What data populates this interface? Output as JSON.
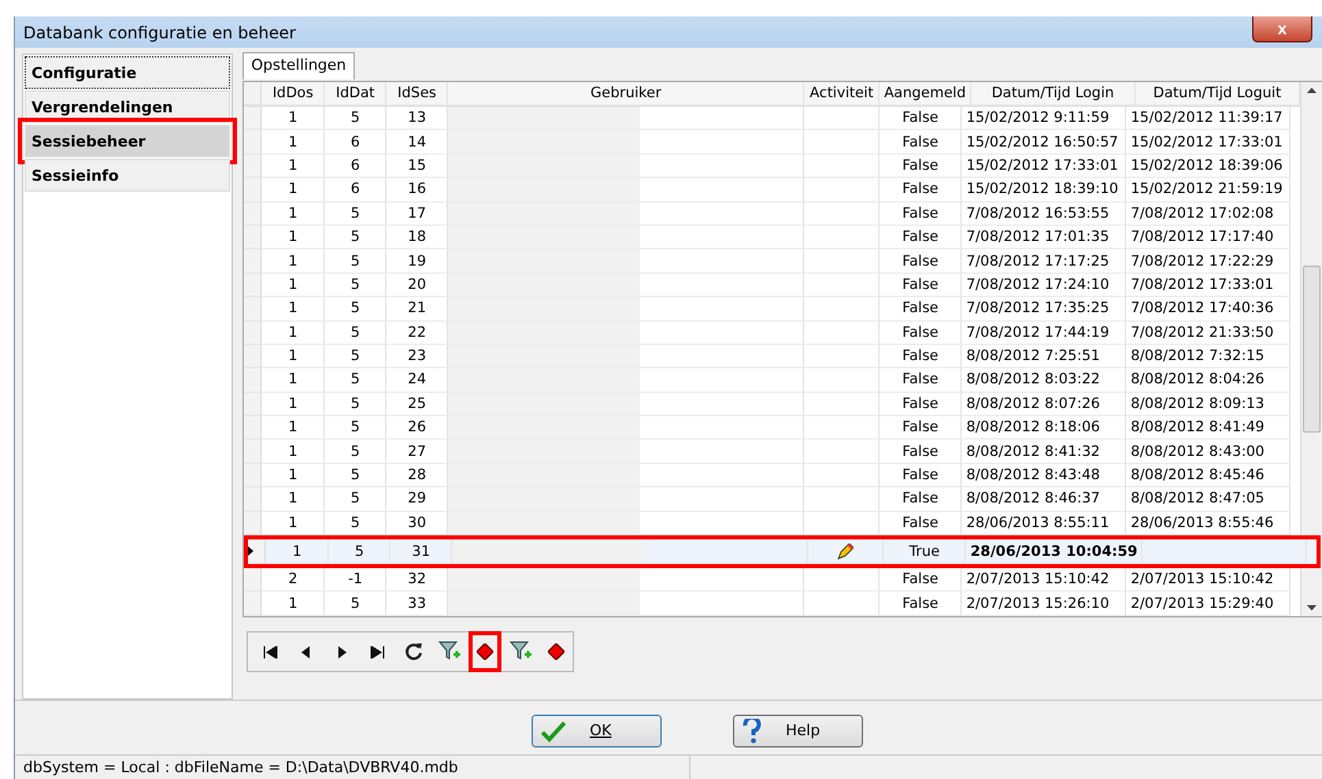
{
  "window": {
    "title": "Databank configuratie en beheer",
    "close": "x"
  },
  "nav": [
    {
      "label": "Configuratie",
      "selected": false,
      "focused": true,
      "highlighted": false
    },
    {
      "label": "Vergrendelingen",
      "selected": false,
      "focused": false,
      "highlighted": false
    },
    {
      "label": "Sessiebeheer",
      "selected": true,
      "focused": false,
      "highlighted": true
    },
    {
      "label": "Sessieinfo",
      "selected": false,
      "focused": false,
      "highlighted": false
    }
  ],
  "tabs": [
    {
      "label": "Opstellingen",
      "selected": true
    }
  ],
  "table": {
    "columns": [
      "IdDos",
      "IdDat",
      "IdSes",
      "Gebruiker",
      "Activiteit",
      "Aangemeld",
      "Datum/Tijd Login",
      "Datum/Tijd Loguit"
    ],
    "rows": [
      {
        "cells": [
          "1",
          "5",
          "13",
          "",
          "",
          "False",
          "15/02/2012 9:11:59",
          "15/02/2012 11:39:17"
        ],
        "selected": false,
        "editing": false
      },
      {
        "cells": [
          "1",
          "6",
          "14",
          "",
          "",
          "False",
          "15/02/2012 16:50:57",
          "15/02/2012 17:33:01"
        ],
        "selected": false,
        "editing": false
      },
      {
        "cells": [
          "1",
          "6",
          "15",
          "",
          "",
          "False",
          "15/02/2012 17:33:01",
          "15/02/2012 18:39:06"
        ],
        "selected": false,
        "editing": false
      },
      {
        "cells": [
          "1",
          "6",
          "16",
          "",
          "",
          "False",
          "15/02/2012 18:39:10",
          "15/02/2012 21:59:19"
        ],
        "selected": false,
        "editing": false
      },
      {
        "cells": [
          "1",
          "5",
          "17",
          "",
          "",
          "False",
          "7/08/2012 16:53:55",
          "7/08/2012 17:02:08"
        ],
        "selected": false,
        "editing": false
      },
      {
        "cells": [
          "1",
          "5",
          "18",
          "",
          "",
          "False",
          "7/08/2012 17:01:35",
          "7/08/2012 17:17:40"
        ],
        "selected": false,
        "editing": false
      },
      {
        "cells": [
          "1",
          "5",
          "19",
          "",
          "",
          "False",
          "7/08/2012 17:17:25",
          "7/08/2012 17:22:29"
        ],
        "selected": false,
        "editing": false
      },
      {
        "cells": [
          "1",
          "5",
          "20",
          "",
          "",
          "False",
          "7/08/2012 17:24:10",
          "7/08/2012 17:33:01"
        ],
        "selected": false,
        "editing": false
      },
      {
        "cells": [
          "1",
          "5",
          "21",
          "",
          "",
          "False",
          "7/08/2012 17:35:25",
          "7/08/2012 17:40:36"
        ],
        "selected": false,
        "editing": false
      },
      {
        "cells": [
          "1",
          "5",
          "22",
          "",
          "",
          "False",
          "7/08/2012 17:44:19",
          "7/08/2012 21:33:50"
        ],
        "selected": false,
        "editing": false
      },
      {
        "cells": [
          "1",
          "5",
          "23",
          "",
          "",
          "False",
          "8/08/2012 7:25:51",
          "8/08/2012 7:32:15"
        ],
        "selected": false,
        "editing": false
      },
      {
        "cells": [
          "1",
          "5",
          "24",
          "",
          "",
          "False",
          "8/08/2012 8:03:22",
          "8/08/2012 8:04:26"
        ],
        "selected": false,
        "editing": false
      },
      {
        "cells": [
          "1",
          "5",
          "25",
          "",
          "",
          "False",
          "8/08/2012 8:07:26",
          "8/08/2012 8:09:13"
        ],
        "selected": false,
        "editing": false
      },
      {
        "cells": [
          "1",
          "5",
          "26",
          "",
          "",
          "False",
          "8/08/2012 8:18:06",
          "8/08/2012 8:41:49"
        ],
        "selected": false,
        "editing": false
      },
      {
        "cells": [
          "1",
          "5",
          "27",
          "",
          "",
          "False",
          "8/08/2012 8:41:32",
          "8/08/2012 8:43:00"
        ],
        "selected": false,
        "editing": false
      },
      {
        "cells": [
          "1",
          "5",
          "28",
          "",
          "",
          "False",
          "8/08/2012 8:43:48",
          "8/08/2012 8:45:46"
        ],
        "selected": false,
        "editing": false
      },
      {
        "cells": [
          "1",
          "5",
          "29",
          "",
          "",
          "False",
          "8/08/2012 8:46:37",
          "8/08/2012 8:47:05"
        ],
        "selected": false,
        "editing": false
      },
      {
        "cells": [
          "1",
          "5",
          "30",
          "",
          "",
          "False",
          "28/06/2013 8:55:11",
          "28/06/2013 8:55:46"
        ],
        "selected": false,
        "editing": false
      },
      {
        "cells": [
          "1",
          "5",
          "31",
          "",
          "",
          "True",
          "28/06/2013 10:04:59",
          ""
        ],
        "selected": true,
        "editing": true
      },
      {
        "cells": [
          "2",
          "-1",
          "32",
          "",
          "",
          "False",
          "2/07/2013 15:10:42",
          "2/07/2013 15:10:42"
        ],
        "selected": false,
        "editing": false
      },
      {
        "cells": [
          "1",
          "5",
          "33",
          "",
          "",
          "False",
          "2/07/2013 15:26:10",
          "2/07/2013 15:29:40"
        ],
        "selected": false,
        "editing": false
      }
    ]
  },
  "toolbar": [
    {
      "kind": "first",
      "highlighted": false
    },
    {
      "kind": "prev",
      "highlighted": false
    },
    {
      "kind": "next",
      "highlighted": false
    },
    {
      "kind": "last",
      "highlighted": false
    },
    {
      "kind": "refresh",
      "highlighted": false
    },
    {
      "kind": "filter",
      "highlighted": false
    },
    {
      "kind": "diamond",
      "highlighted": true
    },
    {
      "kind": "filter",
      "highlighted": false
    },
    {
      "kind": "diamond",
      "highlighted": false
    }
  ],
  "buttons": [
    {
      "kind": "ok",
      "label": "OK"
    },
    {
      "kind": "help",
      "label": "Help"
    }
  ],
  "status_bar": "dbSystem = Local : dbFileName = D:\\Data\\DVBRV40.mdb"
}
